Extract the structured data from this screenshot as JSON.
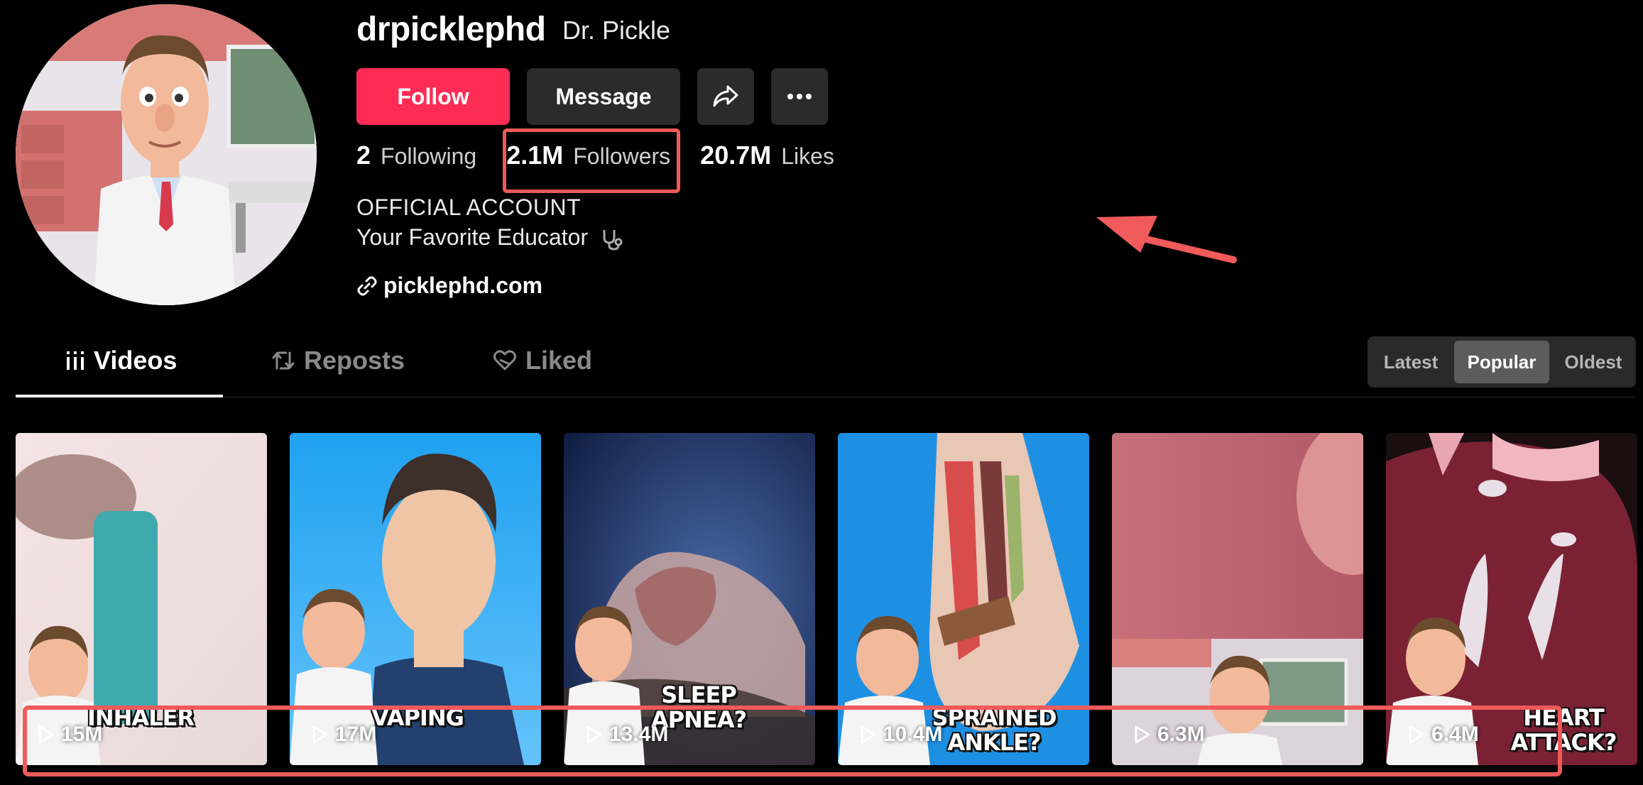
{
  "profile": {
    "username": "drpicklephd",
    "nickname": "Dr. Pickle",
    "bio_line1": "OFFICIAL ACCOUNT",
    "bio_line2": "Your Favorite Educator",
    "link": "picklephd.com"
  },
  "actions": {
    "follow_label": "Follow",
    "message_label": "Message"
  },
  "stats": {
    "following_count": "2",
    "following_label": "Following",
    "followers_count": "2.1M",
    "followers_label": "Followers",
    "likes_count": "20.7M",
    "likes_label": "Likes"
  },
  "tabs": [
    {
      "label": "Videos",
      "icon": "grid-icon",
      "active": true
    },
    {
      "label": "Reposts",
      "icon": "repost-icon",
      "active": false
    },
    {
      "label": "Liked",
      "icon": "liked-heart-icon",
      "active": false
    }
  ],
  "sort": {
    "options": [
      "Latest",
      "Popular",
      "Oldest"
    ],
    "selected": "Popular"
  },
  "videos": [
    {
      "caption": "INHALER",
      "views": "15M"
    },
    {
      "caption": "VAPING",
      "views": "17M"
    },
    {
      "caption": "SLEEP APNEA?",
      "views": "13.4M"
    },
    {
      "caption": "SPRAINED ANKLE?",
      "views": "10.4M"
    },
    {
      "caption": "",
      "views": "6.3M"
    },
    {
      "caption": "HEART ATTACK?",
      "views": "6.4M"
    }
  ],
  "colors": {
    "accent": "#fe2c55",
    "annotation": "#f05a5a",
    "background": "#000000",
    "button_dark": "#2b2b2b"
  }
}
